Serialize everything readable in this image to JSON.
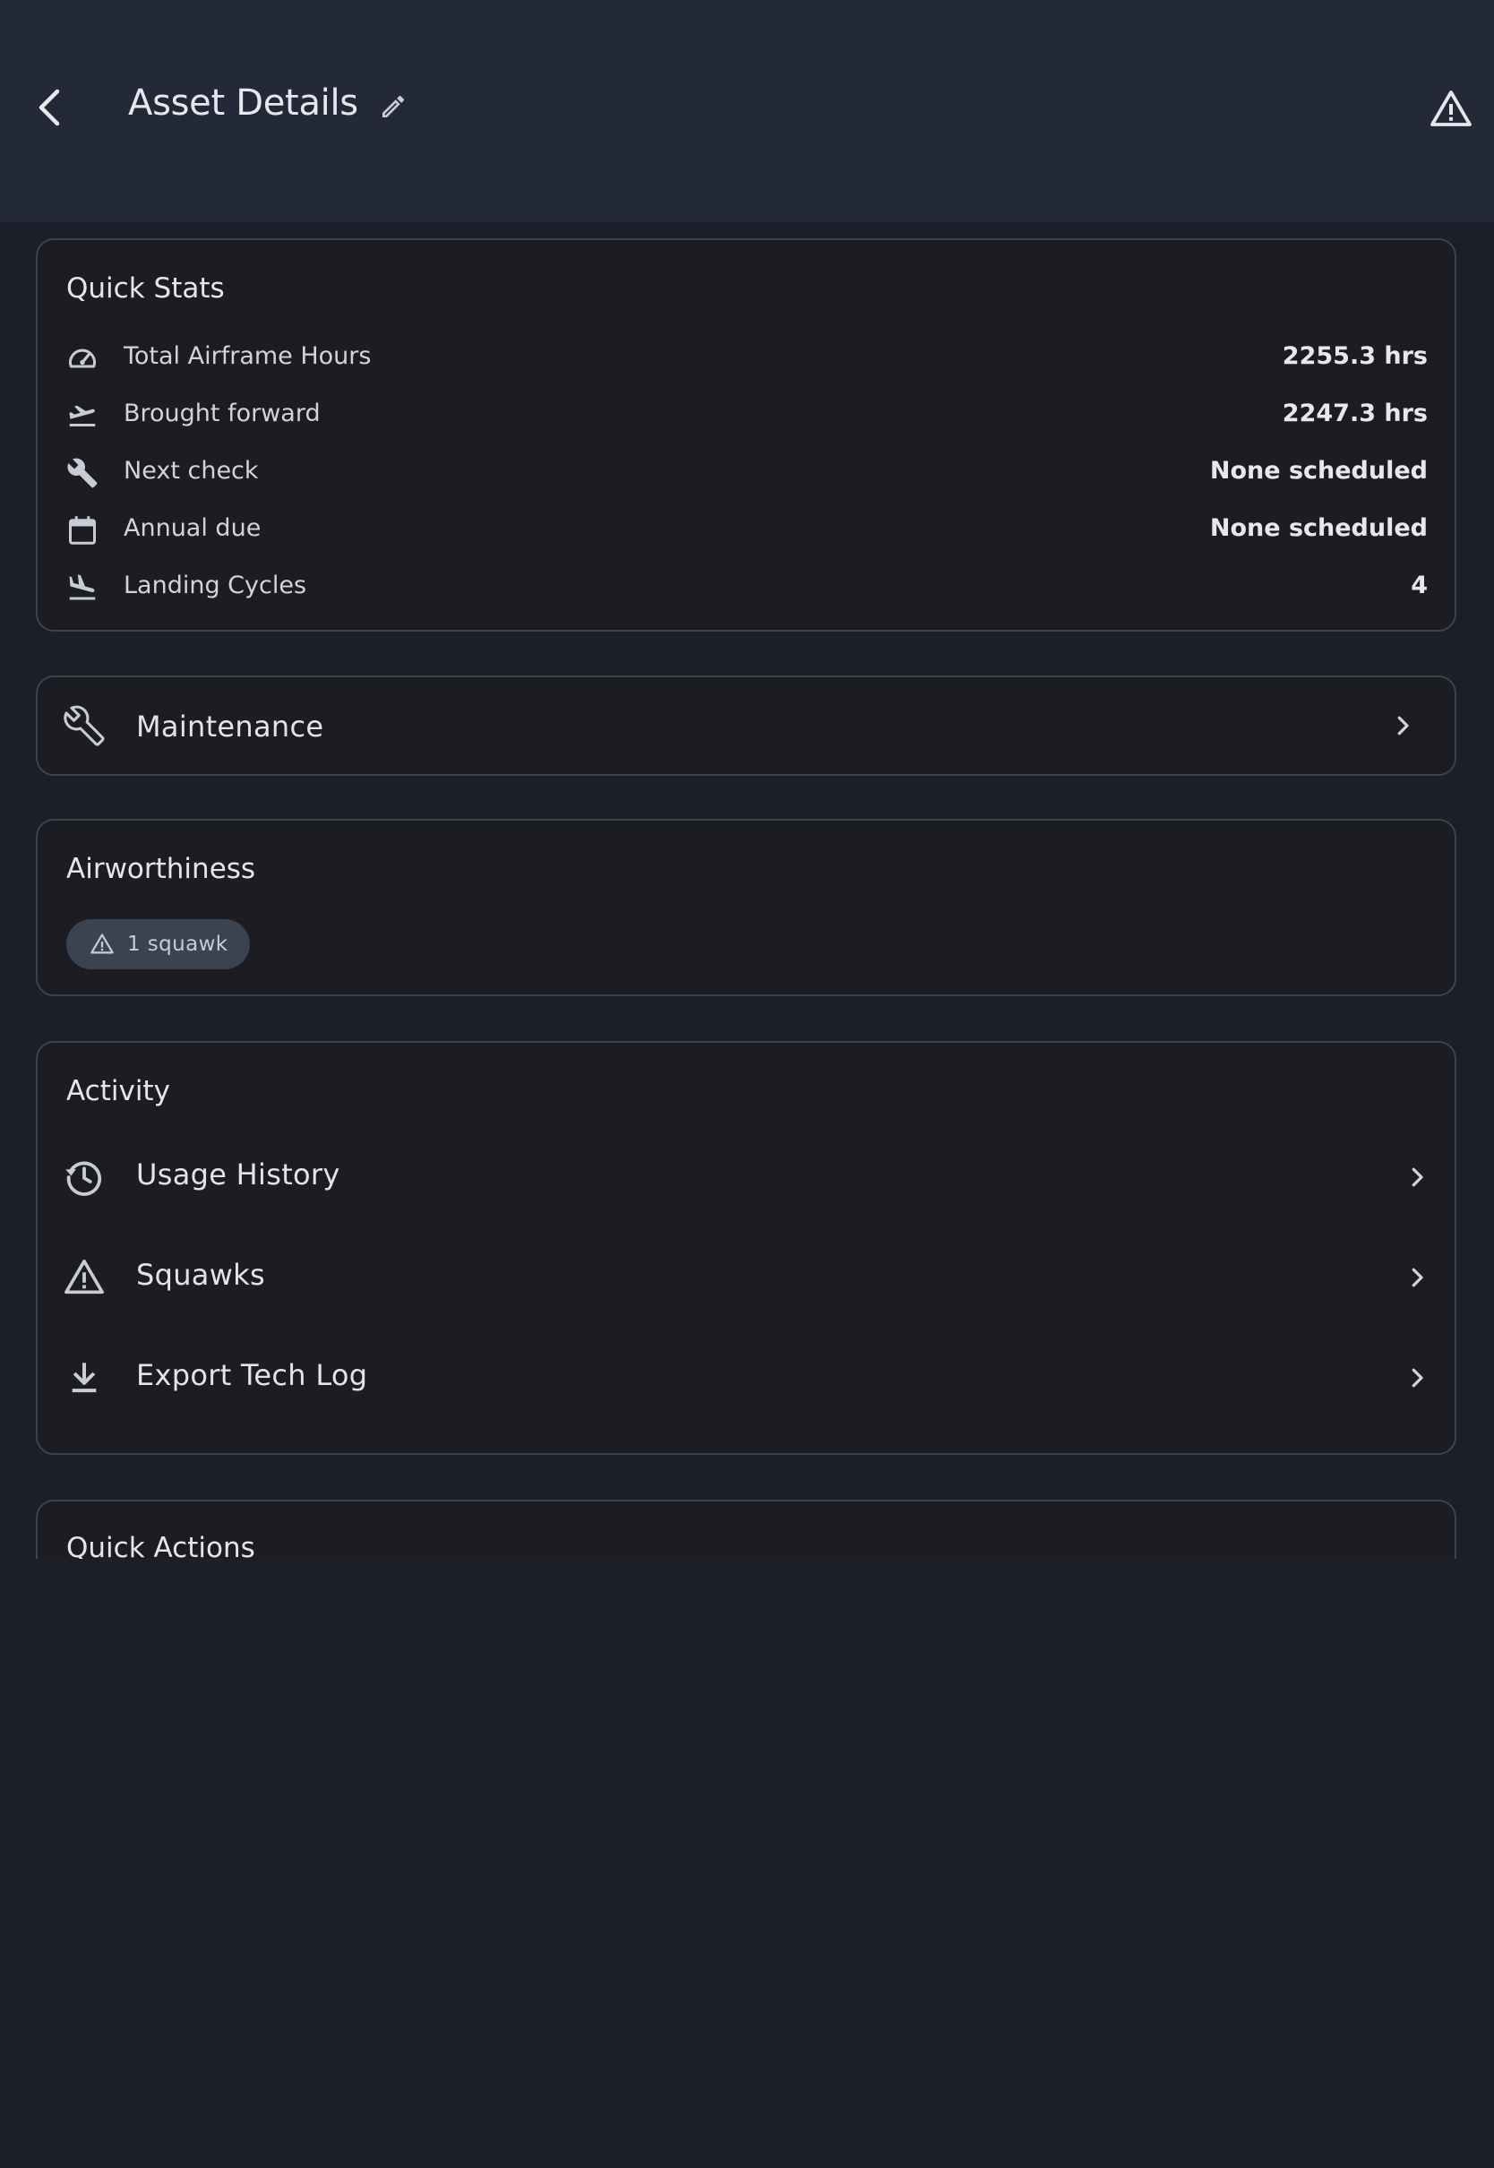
{
  "header": {
    "title": "Asset Details",
    "back_icon": "chevron-left-icon",
    "edit_icon": "pencil-icon",
    "alert_icon": "warning-triangle-icon"
  },
  "quick_stats": {
    "title": "Quick Stats",
    "rows": [
      {
        "icon": "speedometer-icon",
        "label": "Total Airframe Hours",
        "value": "2255.3 hrs"
      },
      {
        "icon": "airplane-takeoff-icon",
        "label": "Brought forward",
        "value": "2247.3 hrs"
      },
      {
        "icon": "wrench-icon",
        "label": "Next check",
        "value": "None scheduled"
      },
      {
        "icon": "calendar-icon",
        "label": "Annual due",
        "value": "None scheduled"
      },
      {
        "icon": "airplane-landing-icon",
        "label": "Landing Cycles",
        "value": "4"
      }
    ]
  },
  "maintenance": {
    "label": "Maintenance",
    "icon": "wrench-outline-icon"
  },
  "airworthiness": {
    "title": "Airworthiness",
    "chip_label": "1 squawk",
    "chip_icon": "warning-triangle-icon"
  },
  "activity": {
    "title": "Activity",
    "items": [
      {
        "icon": "history-icon",
        "label": "Usage History"
      },
      {
        "icon": "warning-triangle-icon",
        "label": "Squawks"
      },
      {
        "icon": "download-icon",
        "label": "Export Tech Log"
      }
    ]
  },
  "quick_actions": {
    "title": "Quick Actions"
  },
  "colors": {
    "background": "#1c1f29",
    "appbar": "#242938",
    "card": "#1b1d22",
    "card_border": "#3e424c",
    "chip": "#3b4250",
    "text_primary": "#e4e6ec"
  }
}
